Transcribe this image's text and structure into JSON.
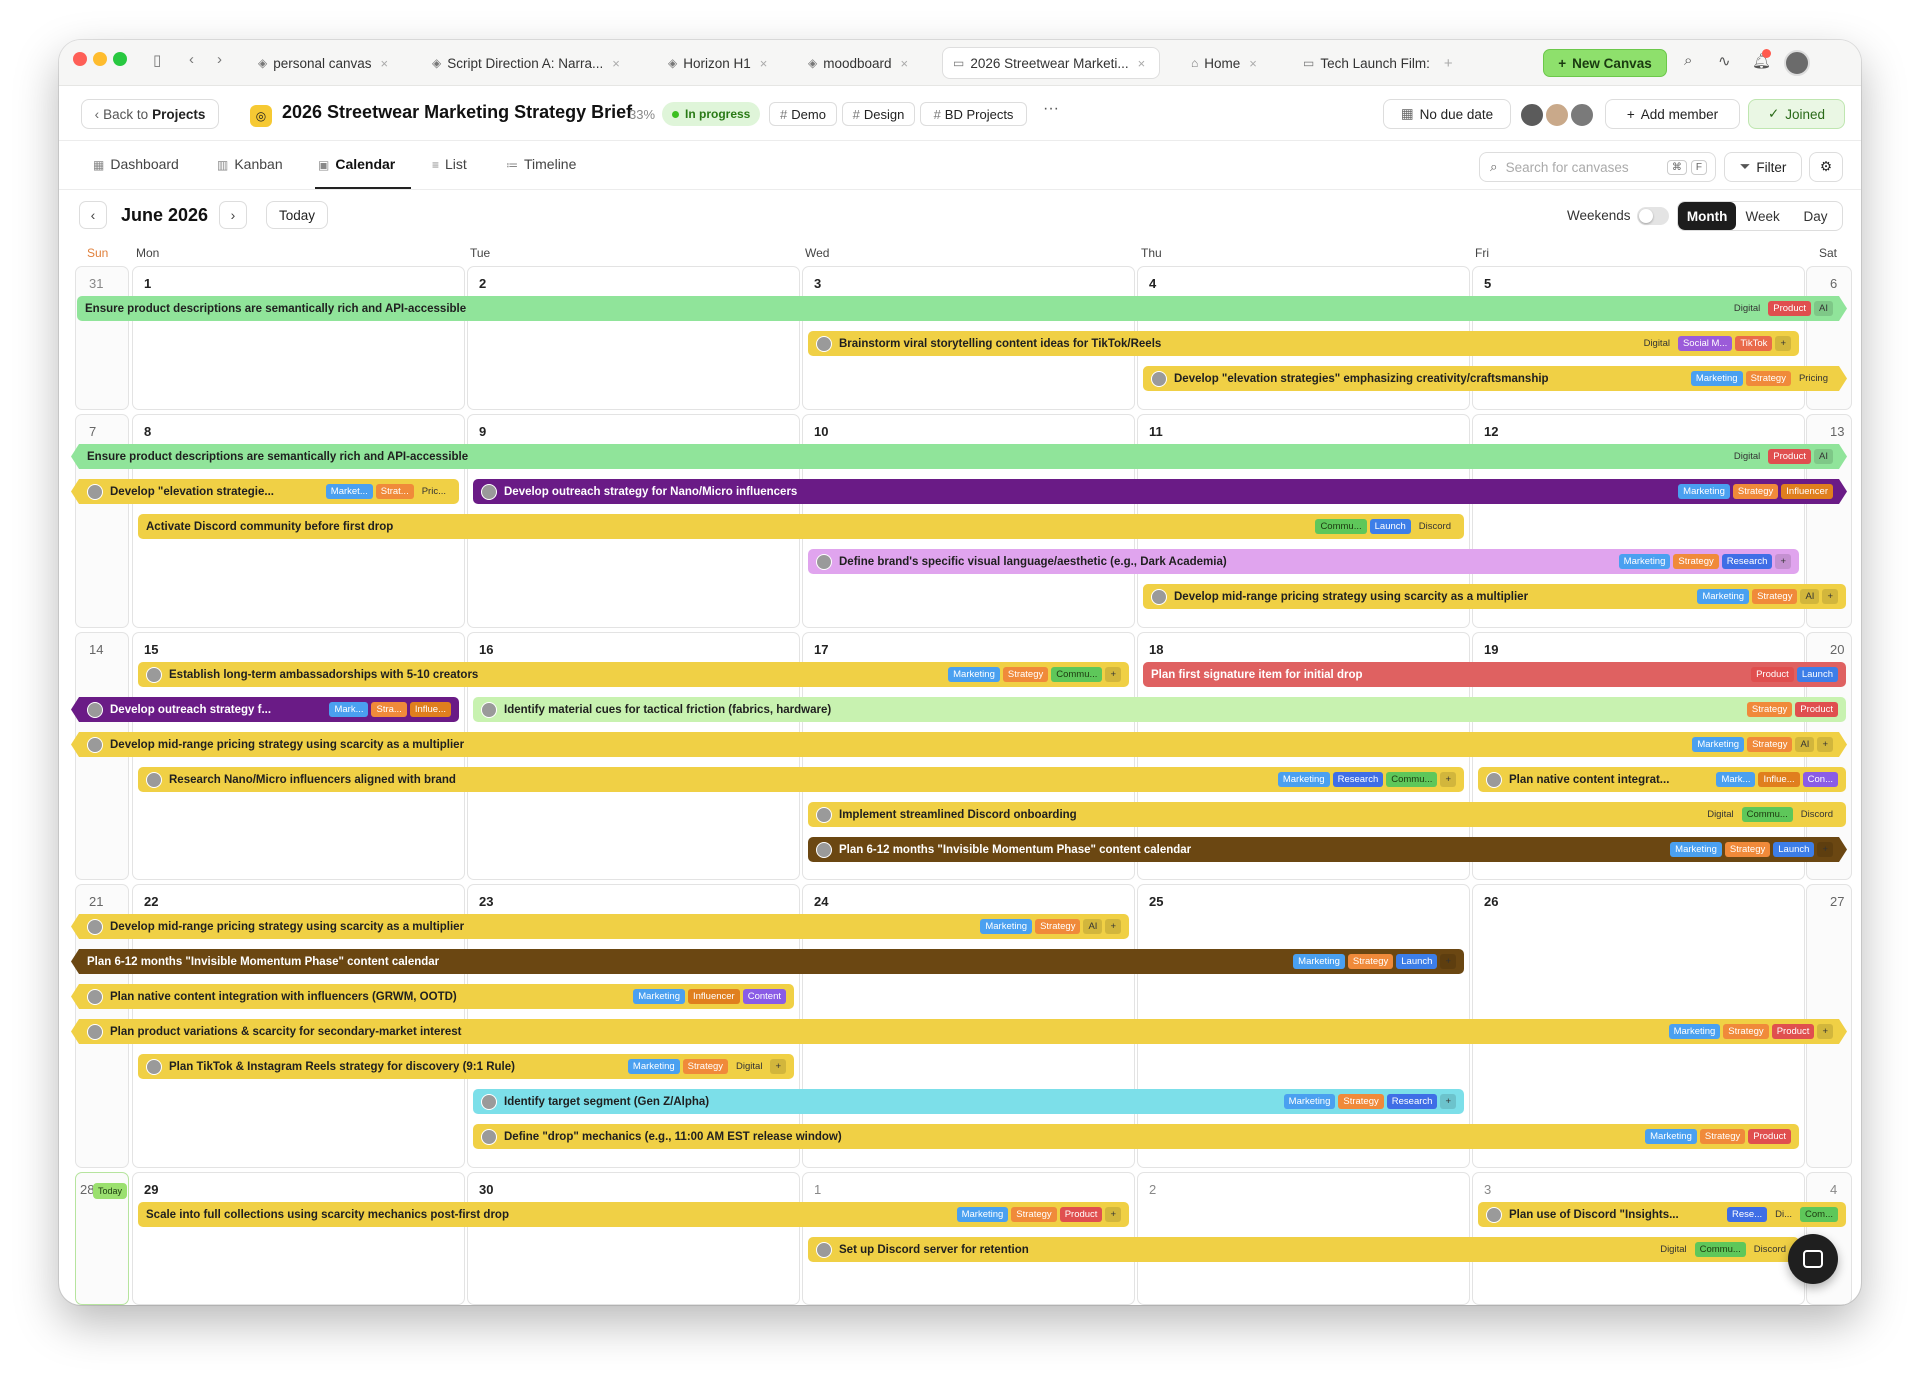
{
  "tabs": [
    {
      "icon": "layers-icon",
      "label": "personal canvas"
    },
    {
      "icon": "layers-icon",
      "label": "Script Direction A: Narra..."
    },
    {
      "icon": "layers-icon",
      "label": "Horizon H1"
    },
    {
      "icon": "layers-icon",
      "label": "moodboard"
    },
    {
      "icon": "folder-icon",
      "label": "2026 Streetwear Marketi...",
      "active": true
    },
    {
      "icon": "home-icon",
      "label": "Home"
    },
    {
      "icon": "folder-icon",
      "label": "Tech Launch Film: "
    }
  ],
  "toolbar": {
    "new_canvas": "New Canvas"
  },
  "project": {
    "back_prefix": "Back to",
    "back_label": "Projects",
    "title": "2026 Streetwear Marketing Strategy Brief",
    "progress": "33%",
    "status": "In progress",
    "tags": [
      "Demo",
      "Design",
      "BD Projects"
    ],
    "due": "No due date",
    "add_member": "Add member",
    "joined": "Joined"
  },
  "views": {
    "dashboard": "Dashboard",
    "kanban": "Kanban",
    "calendar": "Calendar",
    "list": "List",
    "timeline": "Timeline",
    "selected": "Calendar"
  },
  "search": {
    "placeholder": "Search for canvases",
    "key1": "⌘",
    "key2": "F"
  },
  "filter": "Filter",
  "calendar": {
    "month_label": "June 2026",
    "today_label": "Today",
    "weekends_label": "Weekends",
    "weekends_on": false,
    "modes": [
      "Month",
      "Week",
      "Day"
    ],
    "active_mode": "Month",
    "day_names": [
      "Sun",
      "Mon",
      "Tue",
      "Wed",
      "Thu",
      "Fri",
      "Sat"
    ],
    "weeks": [
      {
        "days": [
          "31",
          "1",
          "2",
          "3",
          "4",
          "5",
          "6"
        ],
        "events": [
          {
            "title": "Ensure product descriptions are semantically rich and API-accessible",
            "color": "green",
            "labels": [
              "Digital",
              "Product",
              "AI"
            ]
          },
          {
            "title": "Brainstorm viral storytelling content ideas for TikTok/Reels",
            "color": "yellow",
            "labels": [
              "Digital",
              "Social M...",
              "TikTok",
              "+"
            ]
          },
          {
            "title": "Develop \"elevation strategies\" emphasizing creativity/craftsmanship",
            "color": "yellow",
            "labels": [
              "Marketing",
              "Strategy",
              "Pricing"
            ]
          }
        ]
      },
      {
        "days": [
          "7",
          "8",
          "9",
          "10",
          "11",
          "12",
          "13"
        ],
        "events": [
          {
            "title": "Ensure product descriptions are semantically rich and API-accessible",
            "color": "green",
            "labels": [
              "Digital",
              "Product",
              "AI"
            ]
          },
          {
            "title": "Develop \"elevation strategie...",
            "color": "yellow",
            "labels": [
              "Market...",
              "Strat...",
              "Pric..."
            ]
          },
          {
            "title": "Develop outreach strategy for Nano/Micro influencers",
            "color": "purple",
            "labels": [
              "Marketing",
              "Strategy",
              "Influencer"
            ]
          },
          {
            "title": "Activate Discord community before first drop",
            "color": "yellow",
            "labels": [
              "Commu...",
              "Launch",
              "Discord"
            ]
          },
          {
            "title": "Define brand's specific visual language/aesthetic (e.g., Dark Academia)",
            "color": "pink",
            "labels": [
              "Marketing",
              "Strategy",
              "Research",
              "+"
            ]
          },
          {
            "title": "Develop mid-range pricing strategy using scarcity as a multiplier",
            "color": "yellow",
            "labels": [
              "Marketing",
              "Strategy",
              "AI",
              "+"
            ]
          }
        ]
      },
      {
        "days": [
          "14",
          "15",
          "16",
          "17",
          "18",
          "19",
          "20"
        ],
        "events": [
          {
            "title": "Establish long-term ambassadorships with 5-10 creators",
            "color": "yellow",
            "labels": [
              "Marketing",
              "Strategy",
              "Commu...",
              "+"
            ]
          },
          {
            "title": "Plan first signature item for initial drop",
            "color": "coral",
            "labels": [
              "Product",
              "Launch"
            ]
          },
          {
            "title": "Develop outreach strategy f...",
            "color": "purple",
            "labels": [
              "Mark...",
              "Stra...",
              "Influe..."
            ]
          },
          {
            "title": "Identify material cues for tactical friction (fabrics, hardware)",
            "color": "lime",
            "labels": [
              "Strategy",
              "Product"
            ]
          },
          {
            "title": "Develop mid-range pricing strategy using scarcity as a multiplier",
            "color": "yellow",
            "labels": [
              "Marketing",
              "Strategy",
              "AI",
              "+"
            ]
          },
          {
            "title": "Research Nano/Micro influencers aligned with brand",
            "color": "yellow",
            "labels": [
              "Marketing",
              "Research",
              "Commu...",
              "+"
            ]
          },
          {
            "title": "Plan native content integrat...",
            "color": "yellow",
            "labels": [
              "Mark...",
              "Influe...",
              "Con..."
            ]
          },
          {
            "title": "Implement streamlined Discord onboarding",
            "color": "yellow",
            "labels": [
              "Digital",
              "Commu...",
              "Discord"
            ]
          },
          {
            "title": "Plan 6-12 months \"Invisible Momentum Phase\" content calendar",
            "color": "brown",
            "labels": [
              "Marketing",
              "Strategy",
              "Launch",
              "+"
            ]
          }
        ]
      },
      {
        "days": [
          "21",
          "22",
          "23",
          "24",
          "25",
          "26",
          "27"
        ],
        "events": [
          {
            "title": "Develop mid-range pricing strategy using scarcity as a multiplier",
            "color": "yellow",
            "labels": [
              "Marketing",
              "Strategy",
              "AI",
              "+"
            ]
          },
          {
            "title": "Plan 6-12 months \"Invisible Momentum Phase\" content calendar",
            "color": "brown",
            "labels": [
              "Marketing",
              "Strategy",
              "Launch",
              "+"
            ]
          },
          {
            "title": "Plan native content integration with influencers (GRWM, OOTD)",
            "color": "yellow",
            "labels": [
              "Marketing",
              "Influencer",
              "Content"
            ]
          },
          {
            "title": "Plan product variations & scarcity for secondary-market interest",
            "color": "yellow",
            "labels": [
              "Marketing",
              "Strategy",
              "Product",
              "+"
            ]
          },
          {
            "title": "Plan TikTok & Instagram Reels strategy for discovery (9:1 Rule)",
            "color": "yellow",
            "labels": [
              "Marketing",
              "Strategy",
              "Digital",
              "+"
            ]
          },
          {
            "title": "Identify target segment (Gen Z/Alpha)",
            "color": "cyan",
            "labels": [
              "Marketing",
              "Strategy",
              "Research",
              "+"
            ]
          },
          {
            "title": "Define \"drop\" mechanics (e.g., 11:00 AM EST release window)",
            "color": "yellow",
            "labels": [
              "Marketing",
              "Strategy",
              "Product"
            ]
          }
        ]
      },
      {
        "days": [
          "28",
          "29",
          "30",
          "1",
          "2",
          "3",
          "4"
        ],
        "events": [
          {
            "title": "Scale into full collections using scarcity mechanics post-first drop",
            "color": "yellow",
            "labels": [
              "Marketing",
              "Strategy",
              "Product",
              "+"
            ]
          },
          {
            "title": "Plan use of Discord \"Insights...",
            "color": "yellow",
            "labels": [
              "Rese...",
              "Di...",
              "Com..."
            ]
          },
          {
            "title": "Set up Discord server for retention",
            "color": "yellow",
            "labels": [
              "Digital",
              "Commu...",
              "Discord"
            ]
          }
        ]
      }
    ]
  },
  "colors": {
    "accent": "#8ee06c",
    "green": "#90e49a",
    "yellow": "#f0d045",
    "purple": "#6a1b86",
    "pink": "#e0a4ee",
    "brown": "#6b4712",
    "coral": "#df6161",
    "lime": "#c8f2b0",
    "cyan": "#7cdfe9"
  }
}
